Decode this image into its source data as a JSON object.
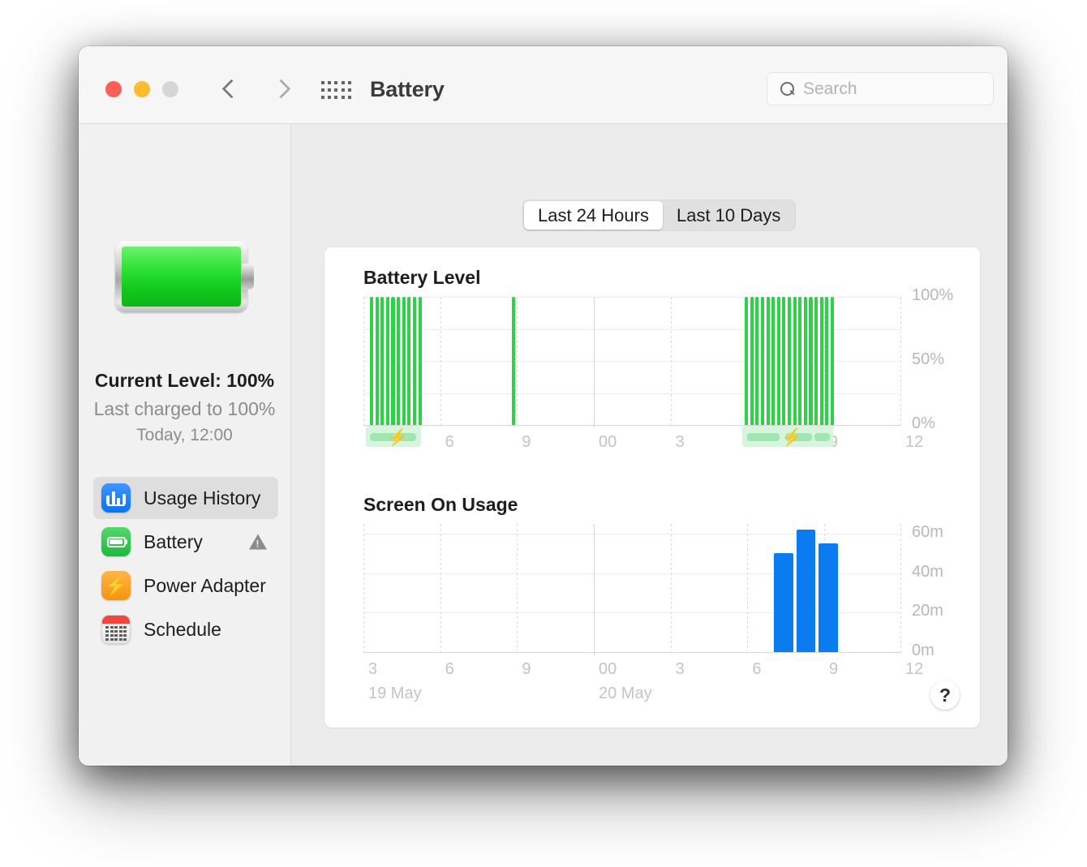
{
  "window": {
    "title": "Battery",
    "traffic_lights": [
      "close",
      "minimize",
      "zoom"
    ],
    "back_label": "Back",
    "forward_label": "Forward",
    "grid_label": "Show All"
  },
  "search": {
    "placeholder": "Search"
  },
  "sidebar": {
    "current_level": "Current Level: 100%",
    "last_charged": "Last charged to 100%",
    "last_charged_time": "Today, 12:00",
    "items": [
      {
        "label": "Usage History",
        "icon": "usage-history-icon",
        "selected": true,
        "badge": ""
      },
      {
        "label": "Battery",
        "icon": "battery-icon",
        "selected": false,
        "badge": "warning"
      },
      {
        "label": "Power Adapter",
        "icon": "power-adapter-icon",
        "selected": false,
        "badge": ""
      },
      {
        "label": "Schedule",
        "icon": "calendar-icon",
        "selected": false,
        "badge": ""
      }
    ]
  },
  "segmented": {
    "options": [
      "Last 24 Hours",
      "Last 10 Days"
    ],
    "selected": "Last 24 Hours"
  },
  "help": {
    "label": "?"
  },
  "colors": {
    "battery_green": "#2fd146",
    "screen_blue": "#0a7cf0",
    "charge_track": "#d6f5dc",
    "charge_segment": "#9fe6b0",
    "accent_selected": "#dedede"
  },
  "chart_data": [
    {
      "type": "bar",
      "title": "Battery Level",
      "xlabel": "",
      "ylabel": "",
      "ylim": [
        0,
        100
      ],
      "yticks": [
        0,
        50,
        100
      ],
      "ytick_labels": [
        "0%",
        "50%",
        "100%"
      ],
      "xtick_labels": [
        "3",
        "6",
        "9",
        "00",
        "3",
        "6",
        "9",
        "12"
      ],
      "xtick_positions": [
        0,
        14.3,
        28.6,
        42.9,
        57.2,
        71.5,
        85.8,
        100
      ],
      "day_labels": [
        {
          "text": "19 May",
          "x_pct": 0
        },
        {
          "text": "20 May",
          "x_pct": 42.9
        }
      ],
      "grid": true,
      "series": [
        {
          "name": "Battery Level",
          "color": "#2fd146",
          "bars": [
            {
              "x_pct": 1.2,
              "value": 100
            },
            {
              "x_pct": 2.2,
              "value": 100
            },
            {
              "x_pct": 3.2,
              "value": 100
            },
            {
              "x_pct": 4.2,
              "value": 100
            },
            {
              "x_pct": 5.2,
              "value": 100
            },
            {
              "x_pct": 6.2,
              "value": 100
            },
            {
              "x_pct": 7.2,
              "value": 100
            },
            {
              "x_pct": 8.2,
              "value": 100
            },
            {
              "x_pct": 9.2,
              "value": 100
            },
            {
              "x_pct": 10.2,
              "value": 100
            },
            {
              "x_pct": 27.6,
              "value": 100
            },
            {
              "x_pct": 71.0,
              "value": 100
            },
            {
              "x_pct": 72.0,
              "value": 100
            },
            {
              "x_pct": 73.0,
              "value": 100
            },
            {
              "x_pct": 74.0,
              "value": 100
            },
            {
              "x_pct": 75.0,
              "value": 100
            },
            {
              "x_pct": 76.0,
              "value": 100
            },
            {
              "x_pct": 77.0,
              "value": 100
            },
            {
              "x_pct": 78.0,
              "value": 100
            },
            {
              "x_pct": 79.0,
              "value": 100
            },
            {
              "x_pct": 80.0,
              "value": 100
            },
            {
              "x_pct": 81.0,
              "value": 100
            },
            {
              "x_pct": 82.0,
              "value": 100
            },
            {
              "x_pct": 83.0,
              "value": 100
            },
            {
              "x_pct": 84.0,
              "value": 100
            },
            {
              "x_pct": 85.0,
              "value": 100
            },
            {
              "x_pct": 86.0,
              "value": 100
            },
            {
              "x_pct": 87.0,
              "value": 100
            }
          ]
        }
      ],
      "charge_periods": [
        {
          "start_pct": 0.5,
          "end_pct": 10.8,
          "segments": [
            [
              1.2,
              9.8
            ]
          ]
        },
        {
          "start_pct": 70.5,
          "end_pct": 87.5,
          "segments": [
            [
              71.5,
              77.5
            ],
            [
              78.5,
              83.5
            ],
            [
              84.0,
              86.8
            ]
          ]
        }
      ]
    },
    {
      "type": "bar",
      "title": "Screen On Usage",
      "xlabel": "",
      "ylabel": "",
      "ylim": [
        0,
        65
      ],
      "yticks": [
        0,
        20,
        40,
        60
      ],
      "ytick_labels": [
        "0m",
        "20m",
        "40m",
        "60m"
      ],
      "xtick_labels": [
        "3",
        "6",
        "9",
        "00",
        "3",
        "6",
        "9",
        "12"
      ],
      "xtick_positions": [
        0,
        14.3,
        28.6,
        42.9,
        57.2,
        71.5,
        85.8,
        100
      ],
      "day_labels": [
        {
          "text": "19 May",
          "x_pct": 0
        },
        {
          "text": "20 May",
          "x_pct": 42.9
        }
      ],
      "grid": true,
      "series": [
        {
          "name": "Screen On Usage",
          "color": "#0a7cf0",
          "bars": [
            {
              "x_pct": 76.5,
              "width_pct": 3.6,
              "value": 50
            },
            {
              "x_pct": 80.6,
              "width_pct": 3.6,
              "value": 62
            },
            {
              "x_pct": 84.7,
              "width_pct": 3.6,
              "value": 55
            }
          ]
        }
      ]
    }
  ]
}
